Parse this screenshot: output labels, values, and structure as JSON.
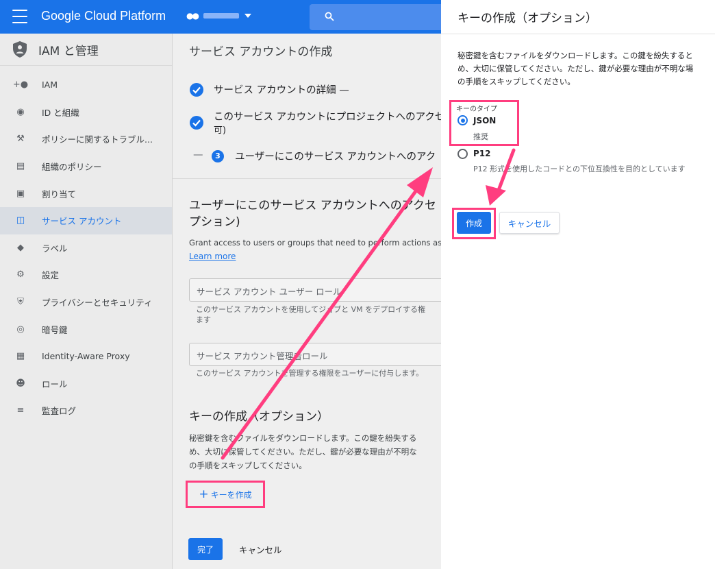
{
  "topbar": {
    "brand": "Google Cloud Platform",
    "project_label": ""
  },
  "sidebar": {
    "title": "IAM と管理",
    "items": [
      {
        "label": "IAM",
        "icon": "person-add-icon"
      },
      {
        "label": "ID と組織",
        "icon": "account-circle-icon"
      },
      {
        "label": "ポリシーに関するトラブル...",
        "icon": "wrench-icon"
      },
      {
        "label": "組織のポリシー",
        "icon": "list-alt-icon"
      },
      {
        "label": "割り当て",
        "icon": "quota-icon"
      },
      {
        "label": "サービス アカウント",
        "icon": "service-account-icon",
        "active": true
      },
      {
        "label": "ラベル",
        "icon": "label-icon"
      },
      {
        "label": "設定",
        "icon": "gear-icon"
      },
      {
        "label": "プライバシーとセキュリティ",
        "icon": "shield-icon"
      },
      {
        "label": "暗号鍵",
        "icon": "key-shield-icon"
      },
      {
        "label": "Identity-Aware Proxy",
        "icon": "proxy-icon"
      },
      {
        "label": "ロール",
        "icon": "roles-icon"
      },
      {
        "label": "監査ログ",
        "icon": "menu-lines-icon"
      }
    ]
  },
  "main": {
    "title": "サービス アカウントの作成",
    "step1": "サービス アカウントの詳細 —",
    "step2_line1": "このサービス アカウントにプロジェクトへのアクセ",
    "step2_line2": "可)",
    "step3_dash": "—",
    "step3_number": "3",
    "step3": "ユーザーにこのサービス アカウントへのアク",
    "section_title_line1": "ユーザーにこのサービス アカウントへのアクセ",
    "section_title_line2": "プション)",
    "section_desc": "Grant access to users or groups that need to perform actions as",
    "learn_more": "Learn more",
    "field_user_role": "サービス アカウント ユーザー ロール",
    "field_user_role_hint1": "このサービス アカウントを使用してジョブと VM をデプロイする権",
    "field_user_role_hint2": "ます",
    "field_admin_role": "サービス アカウント管理者ロール",
    "field_admin_role_hint": "このサービス アカウントを管理する権限をユーザーに付与します。",
    "key_title": "キーの作成（オプション）",
    "key_desc1": "秘密鍵を含むファイルをダウンロードします。この鍵を紛失する",
    "key_desc2": "め、大切に保管してください。ただし、鍵が必要な理由が不明な",
    "key_desc3": "の手順をスキップしてください。",
    "create_key_plus": "+",
    "create_key": "キーを作成",
    "done": "完了",
    "cancel": "キャンセル"
  },
  "panel": {
    "title": "キーの作成（オプション）",
    "desc1": "秘密鍵を含むファイルをダウンロードします。この鍵を紛失すると",
    "desc2": "め、大切に保管してください。ただし、鍵が必要な理由が不明な場",
    "desc3": "の手順をスキップしてください。",
    "key_type_label": "キーのタイプ",
    "options": [
      {
        "label": "JSON",
        "sub": "推奨",
        "selected": true
      },
      {
        "label": "P12",
        "sub": "P12 形式を使用したコードとの下位互換性を目的としています",
        "selected": false
      }
    ],
    "create": "作成",
    "cancel": "キャンセル"
  },
  "colors": {
    "primary": "#1a73e8",
    "highlight": "#ff3d7f"
  }
}
